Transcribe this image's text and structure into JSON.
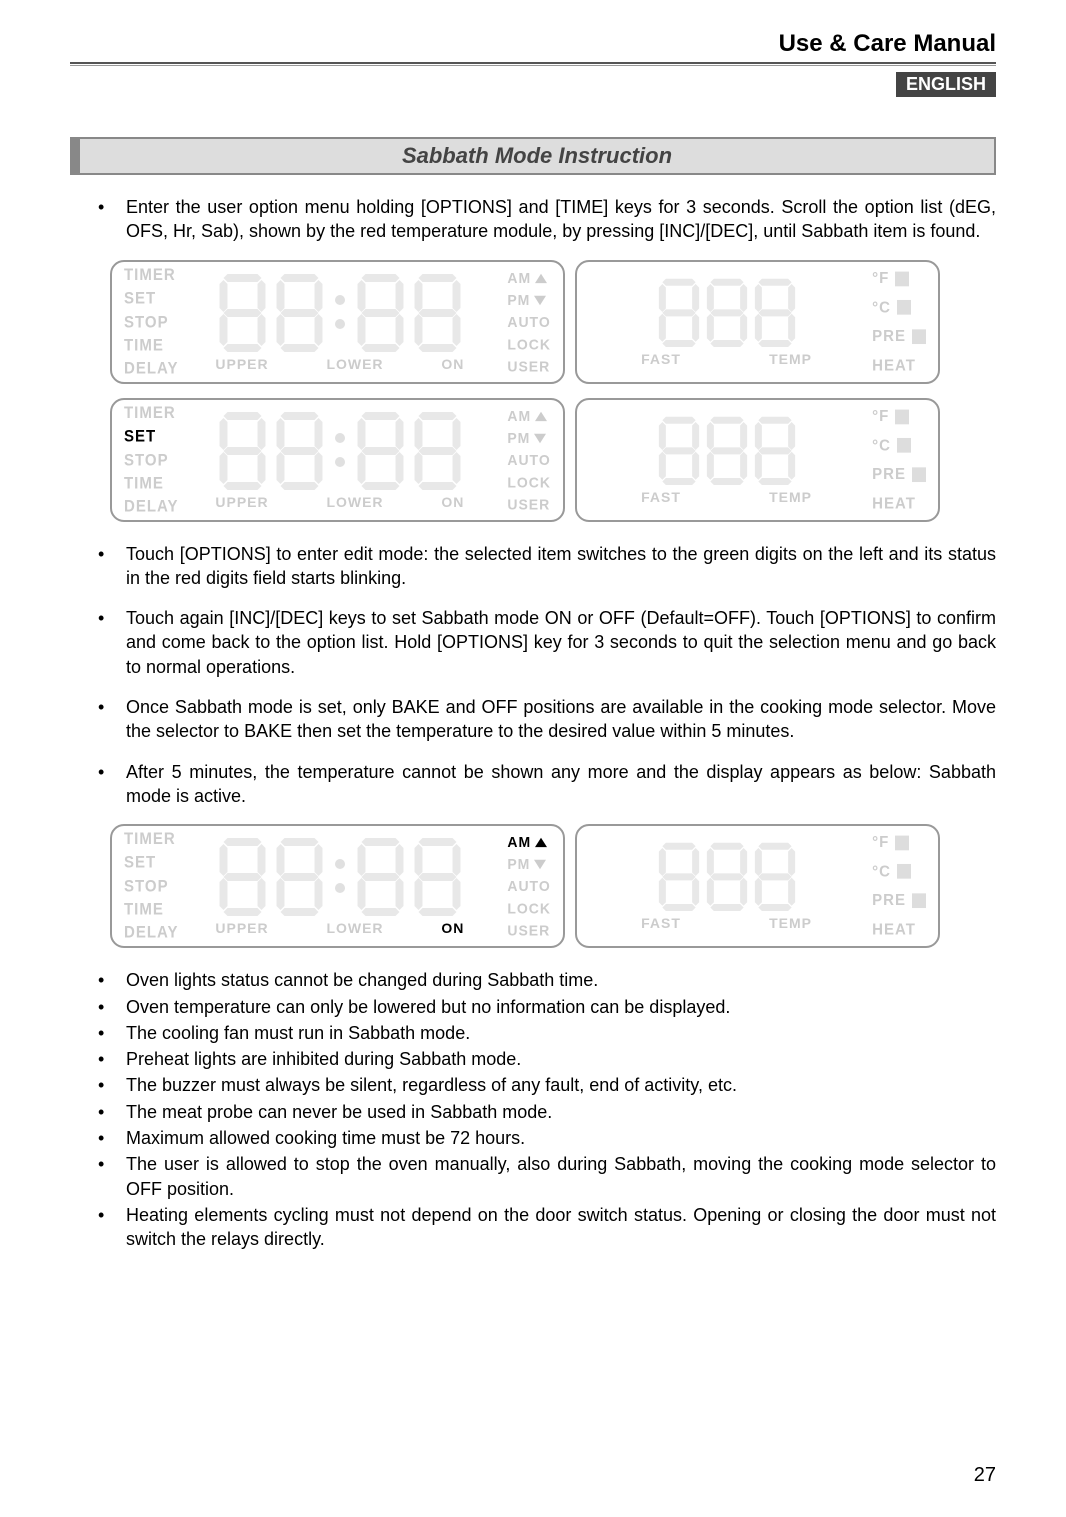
{
  "header": {
    "doc_title": "Use & Care Manual",
    "language": "ENGLISH"
  },
  "section_title": "Sabbath Mode Instruction",
  "instructions_a": [
    "Enter the user option menu holding [OPTIONS] and [TIME] keys for 3 seconds. Scroll the option list (dEG, OFS, Hr, Sab), shown by the red temperature module, by pressing [INC]/[DEC], until Sabbath item is found."
  ],
  "instructions_b": [
    "Touch [OPTIONS] to enter edit mode: the selected item switches to the green digits on the left and its status in the red digits field starts blinking.",
    "Touch again [INC]/[DEC] keys to set Sabbath mode ON or OFF (Default=OFF). Touch [OPTIONS] to confirm and come back to the option list. Hold [OPTIONS] key for 3 seconds to quit the selection menu and go back to normal operations.",
    "Once Sabbath mode is set, only BAKE and OFF positions are available in the cooking mode selector. Move the selector to BAKE then set the temperature to the desired value within 5 minutes.",
    "After 5 minutes, the temperature cannot be shown any more and the display appears as below: Sabbath mode is active."
  ],
  "instructions_c": [
    "Oven lights status cannot be changed during Sabbath time.",
    "Oven temperature can only be lowered but no information can be displayed.",
    "The cooling fan must run in Sabbath mode.",
    "Preheat lights are inhibited during Sabbath mode.",
    "The buzzer must always be silent, regardless of any fault, end of activity, etc.",
    "The meat probe can never be used in Sabbath mode.",
    "Maximum allowed cooking time must be 72 hours.",
    "The user is allowed to stop the oven manually, also during Sabbath, moving the cooking mode selector to OFF position.",
    "Heating elements cycling must not depend on the door switch status.  Opening or closing the door must not switch the relays directly."
  ],
  "panel_labels": {
    "left_col": [
      "TIMER",
      "SET",
      "STOP",
      "TIME",
      "DELAY"
    ],
    "under": [
      "UPPER",
      "LOWER",
      "ON"
    ],
    "ampm": [
      "AM",
      "PM",
      "AUTO",
      "LOCK",
      "USER"
    ],
    "right_under": [
      "FAST",
      "TEMP"
    ],
    "right_col": [
      "°F",
      "°C",
      "PRE",
      "HEAT"
    ]
  },
  "page_number": "27"
}
